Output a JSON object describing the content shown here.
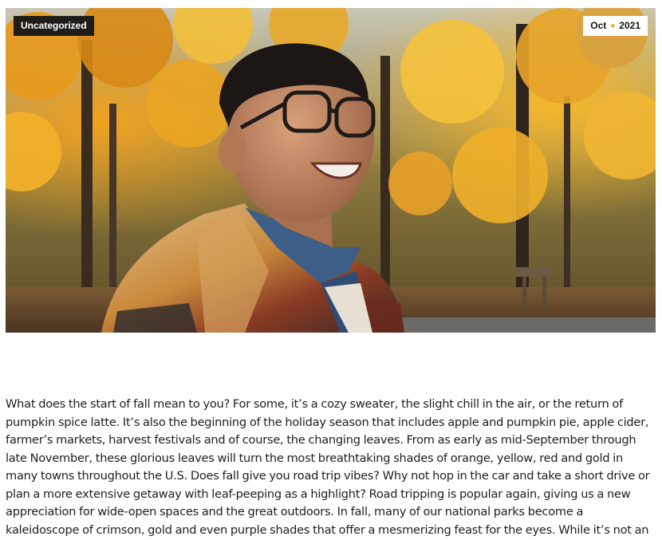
{
  "post": {
    "category_label": "Uncategorized",
    "date": {
      "month": "Oct",
      "separator_icon": "dot-icon",
      "year": "2021"
    },
    "featured_image": {
      "icon": "photo-icon"
    },
    "body_text": "What does the start of fall mean to you? For some, it’s a cozy sweater, the slight chill in the air, or the return of pumpkin spice latte. It’s also the beginning of the holiday season that includes apple and pumpkin pie, apple cider, farmer’s markets, harvest festivals and of course, the changing leaves. From as early as mid-September through late November, these glorious leaves will turn the most breathtaking shades of orange, yellow, red and gold in many towns throughout the U.S. Does fall give you road trip vibes? Why not hop in the car and take a short drive or plan a more extensive getaway with leaf-peeping as a highlight? Road tripping is popular again, giving us a new appreciation for wide-open spaces and the great outdoors. In fall, many of our national parks become a kaleidoscope of crimson, gold and even purple shades that offer a mesmerizing feast for the eyes. While it’s not an"
  },
  "colors": {
    "badge_dark": "#1f1d1a",
    "badge_light": "#ffffff",
    "date_dot": "#f2a51c",
    "text": "#1e1e1e"
  }
}
